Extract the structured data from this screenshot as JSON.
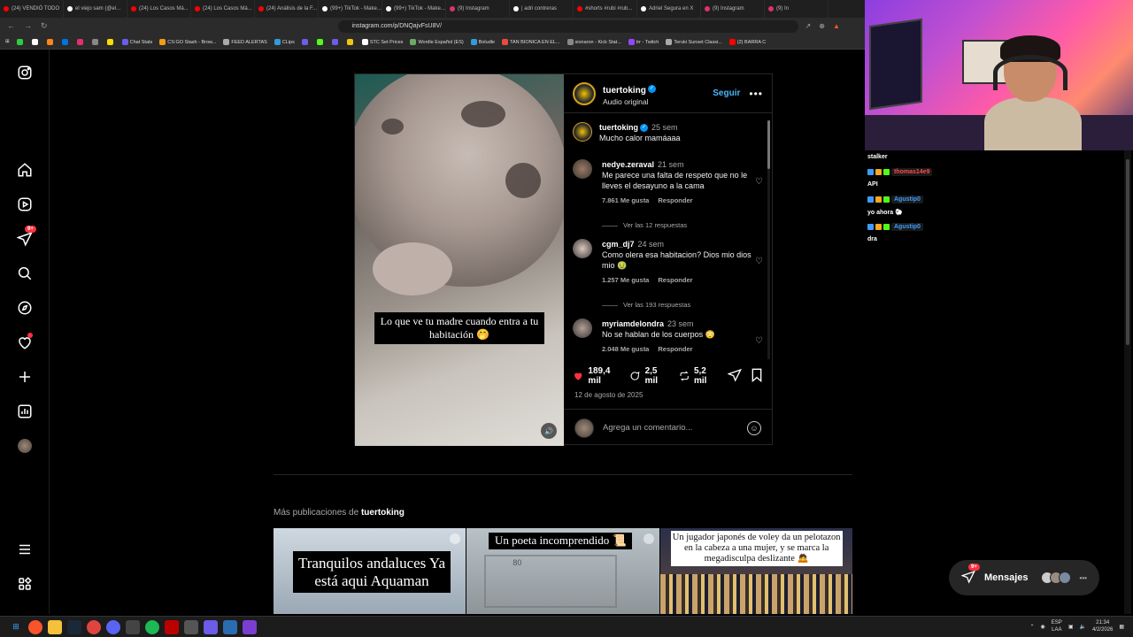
{
  "browser": {
    "tabs": [
      {
        "title": "(24) VENDIÓ TODO",
        "color": "#ff0000"
      },
      {
        "title": "el viejo sam (@el...",
        "color": "#ffffff"
      },
      {
        "title": "(24) Los Casos Má...",
        "color": "#ff0000"
      },
      {
        "title": "(24) Los Casos Má...",
        "color": "#ff0000"
      },
      {
        "title": "(24) Análisis de la F...",
        "color": "#ff0000"
      },
      {
        "title": "(99+) TikTok - Make...",
        "color": "#ffffff"
      },
      {
        "title": "(99+) TikTok - Make...",
        "color": "#ffffff"
      },
      {
        "title": "(9) Instagram",
        "color": "#e1306c"
      },
      {
        "title": "| adri contreras",
        "color": "#ffffff"
      },
      {
        "title": "#shorts #rubi #rub...",
        "color": "#ff0000"
      },
      {
        "title": "Adriel Segura en X",
        "color": "#ffffff"
      },
      {
        "title": "(9) Instagram",
        "color": "#e1306c"
      },
      {
        "title": "(9) In",
        "color": "#e1306c"
      }
    ],
    "url": "instagram.com/p/DNQajvFsU8V/",
    "bookmarks": [
      {
        "label": "",
        "color": "#2ecc40"
      },
      {
        "label": "",
        "color": "#ffffff"
      },
      {
        "label": "",
        "color": "#ff851b"
      },
      {
        "label": "",
        "color": "#0074d9"
      },
      {
        "label": "",
        "color": "#e1306c"
      },
      {
        "label": "",
        "color": "#888888"
      },
      {
        "label": "",
        "color": "#ffdc00"
      },
      {
        "label": "Chat Stats",
        "color": "#6c5ce7"
      },
      {
        "label": "CS:GO Stash - Brow...",
        "color": "#f39c12"
      },
      {
        "label": "FEED ALERTAS",
        "color": "#aaaaaa"
      },
      {
        "label": "CLips",
        "color": "#3498db"
      },
      {
        "label": "",
        "color": "#6c5ce7"
      },
      {
        "label": "",
        "color": "#53fc18"
      },
      {
        "label": "",
        "color": "#6c5ce7"
      },
      {
        "label": "",
        "color": "#f1c40f"
      },
      {
        "label": "STC Set Prices",
        "color": "#ffffff"
      },
      {
        "label": "Wordle Español (ES)",
        "color": "#6aaa64"
      },
      {
        "label": "Boludle",
        "color": "#3498db"
      },
      {
        "label": "TAN BIONICA EN EL...",
        "color": "#e74c3c"
      },
      {
        "label": "sionaron - Kick Stat...",
        "color": "#888888"
      },
      {
        "label": "trr - Twitch",
        "color": "#9146ff"
      },
      {
        "label": "Teruki Sunset Classi...",
        "color": "#aaaaaa"
      },
      {
        "label": "(2) BARRA C",
        "color": "#ff0000"
      }
    ]
  },
  "sidebar": {
    "messages_badge": "9+"
  },
  "post": {
    "username": "tuertoking",
    "audio": "Audio original",
    "follow_label": "Seguir",
    "video_caption": "Lo que ve tu madre cuando entra a tu habitación 🤭",
    "caption": {
      "user": "tuertoking",
      "time": "25 sem",
      "text": "Mucho calor mamáaaa"
    },
    "comments": [
      {
        "user": "nedye.zeraval",
        "time": "21 sem",
        "text": "Me parece una falta de respeto que no le lleves el desayuno a la cama",
        "likes": "7.861 Me gusta",
        "reply": "Responder",
        "replies": "Ver las 12 respuestas",
        "avatar": "#9a7b66"
      },
      {
        "user": "cgm_dj7",
        "time": "24 sem",
        "text": "Como olera esa habitacion? Dios mio dios mio 🤢",
        "likes": "1.257 Me gusta",
        "reply": "Responder",
        "replies": "Ver las 193 respuestas",
        "avatar": "#d8c8c0"
      },
      {
        "user": "myriamdelondra",
        "time": "23 sem",
        "text": "No se hablan de los cuerpos 😳",
        "likes": "2.048 Me gusta",
        "reply": "Responder",
        "replies": "",
        "avatar": "#b0a098"
      }
    ],
    "likes": "189,4 mil",
    "comments_count": "2,5 mil",
    "reposts": "5,2 mil",
    "date": "12 de agosto de 2025",
    "add_comment_placeholder": "Agrega un comentario..."
  },
  "more_posts": {
    "prefix": "Más publicaciones de",
    "user": "tuertoking",
    "items": [
      {
        "caption": "Tranquilos andaluces Ya está aqui Aquaman"
      },
      {
        "caption": "Un poeta incomprendido 📜",
        "sign": "80"
      },
      {
        "caption": "Un jugador japonés de voley da un pelotazon en la cabeza a una mujer, y se marca la megadisculpa deslizante 🙇"
      }
    ]
  },
  "messages": {
    "label": "Mensajes",
    "badge": "9+"
  },
  "stream_chat": [
    {
      "name": "",
      "text": "stalker",
      "name_color": ""
    },
    {
      "name": "thomas14e9",
      "text": "API",
      "name_color": "#ff4d4d"
    },
    {
      "name": "Agustip0",
      "text": "yo ahora 🐑",
      "name_color": "#3d9cff"
    },
    {
      "name": "Agustip0",
      "text": "dra",
      "name_color": "#3d9cff"
    }
  ],
  "taskbar": {
    "lang": "ESP",
    "lang2": "LAA",
    "time": "21:34",
    "date": "4/2/2026"
  }
}
